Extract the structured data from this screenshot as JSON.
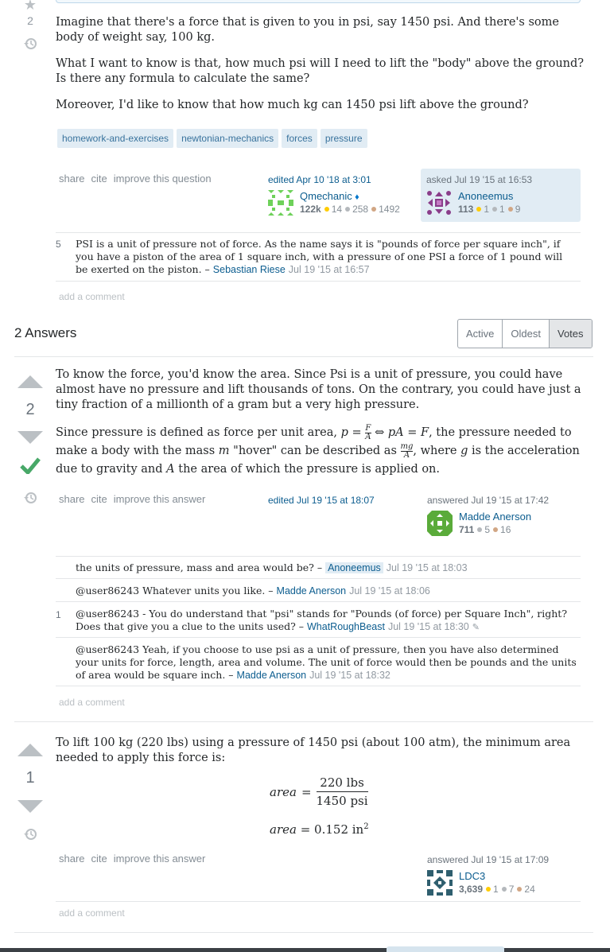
{
  "question": {
    "vote_count": "2",
    "paragraphs": {
      "p1": "Imagine that there's a force that is given to you in psi, say 1450 psi. And there's some body of weight say, 100 kg.",
      "p2": "What I want to know is that, how much psi will I need to lift the \"body\" above the ground? Is there any formula to calculate the same?",
      "p3": "Moreover, I'd like to know that how much kg can 1450 psi lift above the ground?"
    },
    "tags": [
      "homework-and-exercises",
      "newtonian-mechanics",
      "forces",
      "pressure"
    ],
    "menu": {
      "share": "share",
      "cite": "cite",
      "improve": "improve this question"
    },
    "edited": {
      "label": "edited Apr 10 '18 at 3:01",
      "user": "Qmechanic",
      "diamond": "♦",
      "rep": "122k",
      "gold": "14",
      "silver": "258",
      "bronze": "1492"
    },
    "asked": {
      "label": "asked Jul 19 '15 at 16:53",
      "user": "Anoneemus",
      "rep": "113",
      "gold": "1",
      "silver": "1",
      "bronze": "9"
    },
    "comment": {
      "score": "5",
      "text": "PSI is a unit of pressure not of force. As the name says it is \"pounds of force per square inch\", if you have a piston of the area of 1 square inch, with a pressure of one PSI a force of 1 pound will be exerted on the piston. –",
      "user": "Sebastian Riese",
      "time": "Jul 19 '15 at 16:57"
    },
    "add_comment": "add a comment"
  },
  "answers_header": {
    "title": "2 Answers",
    "tabs": [
      "Active",
      "Oldest",
      "Votes"
    ]
  },
  "answer1": {
    "vote_count": "2",
    "p1": "To know the force, you'd know the area. Since Psi is a unit of pressure, you could have almost have no pressure and lift thousands of tons. On the contrary, you could have just a tiny fraction of a millionth of a gram but a very high pressure.",
    "p2a": "Since pressure is defined as force per unit area,",
    "p2b": ", the pressure needed to make a body with the mass",
    "p2c": "\"hover\" can be described as",
    "p2d": ", where",
    "p2e": "is the acceleration due to gravity and",
    "p2f": "the area of which the pressure is applied on.",
    "menu": {
      "share": "share",
      "cite": "cite",
      "improve": "improve this answer"
    },
    "edited": "edited Jul 19 '15 at 18:07",
    "answered": {
      "label": "answered Jul 19 '15 at 17:42",
      "user": "Madde Anerson",
      "rep": "711",
      "silver": "5",
      "bronze": "16"
    },
    "comments": [
      {
        "score": "",
        "text": "the units of pressure, mass and area would be? –",
        "user": "Anoneemus",
        "time": "Jul 19 '15 at 18:03"
      },
      {
        "score": "",
        "text": "@user86243 Whatever units you like. –",
        "user": "Madde Anerson",
        "time": "Jul 19 '15 at 18:06"
      },
      {
        "score": "1",
        "text": "@user86243 - You do understand that \"psi\" stands for \"Pounds (of force) per Square Inch\", right? Does that give you a clue to the units used? –",
        "user": "WhatRoughBeast",
        "time": "Jul 19 '15 at 18:30"
      },
      {
        "score": "",
        "text": "@user86243 Yeah, if you choose to use psi as a unit of pressure, then you have also determined your units for force, length, area and volume. The unit of force would then be pounds and the units of area would be square inch. –",
        "user": "Madde Anerson",
        "time": "Jul 19 '15 at 18:32"
      }
    ],
    "add_comment": "add a comment"
  },
  "answer2": {
    "vote_count": "1",
    "p1": "To lift 100 kg (220 lbs) using a pressure of 1450 psi (about 100 atm), the minimum area needed to apply this force is:",
    "eq1": {
      "lhs": "area",
      "num": "220 lbs",
      "den": "1450 psi"
    },
    "eq2": {
      "lhs": "area",
      "rhs": "0.152 in"
    },
    "menu": {
      "share": "share",
      "cite": "cite",
      "improve": "improve this answer"
    },
    "answered": {
      "label": "answered Jul 19 '15 at 17:09",
      "user": "LDC3",
      "rep": "3,639",
      "gold": "1",
      "silver": "7",
      "bronze": "24"
    },
    "add_comment": "add a comment"
  }
}
